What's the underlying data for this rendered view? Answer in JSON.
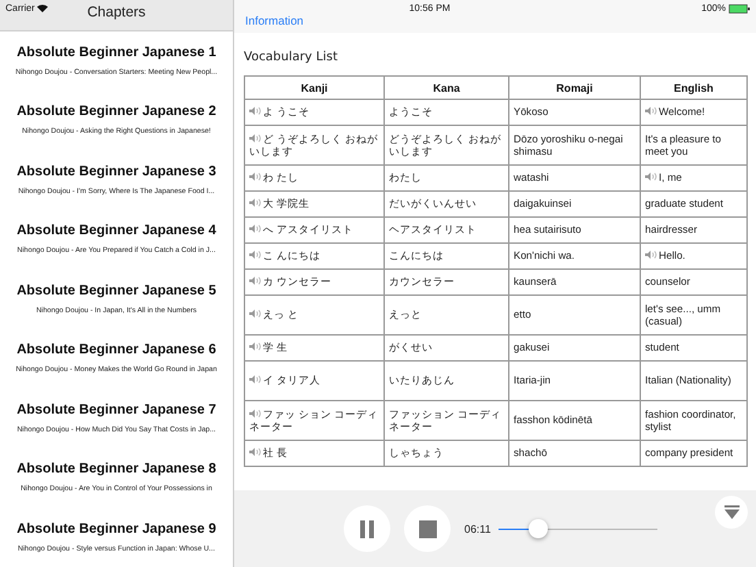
{
  "status_bar": {
    "carrier": "Carrier",
    "time": "10:56 PM",
    "battery": "100%"
  },
  "sidebar": {
    "title": "Chapters",
    "items": [
      {
        "title": "Absolute Beginner Japanese 1",
        "subtitle": "Nihongo Doujou - Conversation Starters: Meeting New Peopl..."
      },
      {
        "title": "Absolute Beginner Japanese 2",
        "subtitle": "Nihongo Doujou - Asking the Right Questions in Japanese!"
      },
      {
        "title": "Absolute Beginner Japanese 3",
        "subtitle": "Nihongo Doujou - I'm Sorry, Where Is The Japanese Food I..."
      },
      {
        "title": "Absolute Beginner Japanese 4",
        "subtitle": "Nihongo Doujou - Are You Prepared if You Catch a Cold in J..."
      },
      {
        "title": "Absolute Beginner Japanese 5",
        "subtitle": "Nihongo Doujou - In Japan, It's All in the Numbers"
      },
      {
        "title": "Absolute Beginner Japanese 6",
        "subtitle": "Nihongo Doujou - Money Makes the World Go Round in Japan"
      },
      {
        "title": "Absolute Beginner Japanese 7",
        "subtitle": "Nihongo Doujou - How Much Did You Say That Costs in Jap..."
      },
      {
        "title": "Absolute Beginner Japanese 8",
        "subtitle": "Nihongo Doujou - Are You in Control of Your Possessions in"
      },
      {
        "title": "Absolute Beginner Japanese 9",
        "subtitle": "Nihongo Doujou - Style versus Function in Japan: Whose U..."
      }
    ]
  },
  "nav": {
    "back_link": "Information"
  },
  "vocabulary": {
    "title": "Vocabulary List",
    "columns": [
      "Kanji",
      "Kana",
      "Romaji",
      "English"
    ],
    "rows": [
      {
        "kanji": "よ うこそ",
        "kana": "ようこそ",
        "romaji": "Yōkoso",
        "english": "Welcome!",
        "english_audio": true
      },
      {
        "kanji": "ど うぞよろしく おねがいします",
        "kana": "どうぞよろしく おねがいします",
        "romaji": "Dōzo yoroshiku o-negai shimasu",
        "english": "It's a pleasure to meet you",
        "english_audio": false
      },
      {
        "kanji": "わ たし",
        "kana": "わたし",
        "romaji": "watashi",
        "english": "I, me",
        "english_audio": true
      },
      {
        "kanji": "大 学院生",
        "kana": "だいがくいんせい",
        "romaji": "daigakuinsei",
        "english": "graduate student",
        "english_audio": false
      },
      {
        "kanji": "へ アスタイリスト",
        "kana": "ヘアスタイリスト",
        "romaji": "hea sutairisuto",
        "english": "hairdresser",
        "english_audio": false
      },
      {
        "kanji": "こ んにちは",
        "kana": "こんにちは",
        "romaji": "Kon'nichi wa.",
        "english": "Hello.",
        "english_audio": true
      },
      {
        "kanji": "カ ウンセラー",
        "kana": "カウンセラー",
        "romaji": "kaunserā",
        "english": "counselor",
        "english_audio": false
      },
      {
        "kanji": "えっ と",
        "kana": "えっと",
        "romaji": "etto",
        "english": "let's see..., umm (casual)",
        "english_audio": false
      },
      {
        "kanji": "学 生",
        "kana": "がくせい",
        "romaji": "gakusei",
        "english": "student",
        "english_audio": false
      },
      {
        "kanji": "イ タリア人",
        "kana": "いたりあじん",
        "romaji": "Itaria-jin",
        "english": "Italian (Nationality)",
        "english_audio": false
      },
      {
        "kanji": "ファッ ション コーディネーター",
        "kana": "ファッション コーディネーター",
        "romaji": "fasshon kōdinētā",
        "english": "fashion coordinator, stylist",
        "english_audio": false
      },
      {
        "kanji": "社 長",
        "kana": "しゃちょう",
        "romaji": "shachō",
        "english": "company president",
        "english_audio": false
      }
    ]
  },
  "player": {
    "elapsed": "06:11",
    "level": 0.25
  }
}
